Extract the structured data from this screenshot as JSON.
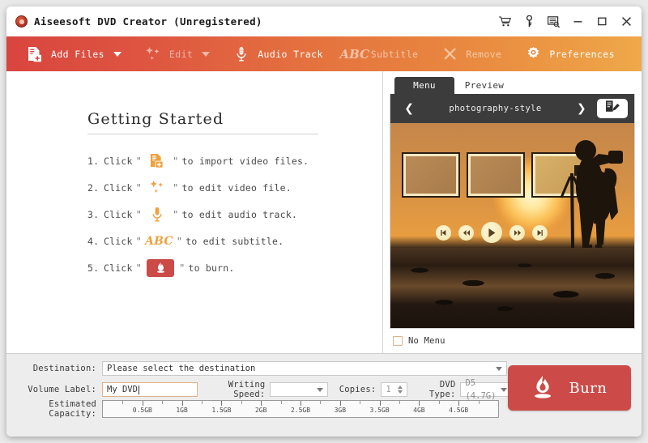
{
  "window": {
    "title": "Aiseesoft DVD Creator (Unregistered)",
    "logo_icon": "app-logo-icon",
    "controls": [
      {
        "name": "cart-icon",
        "label": "Cart"
      },
      {
        "name": "key-icon",
        "label": "Register"
      },
      {
        "name": "feedback-icon",
        "label": "Feedback"
      },
      {
        "name": "minimize-icon",
        "label": "Minimize"
      },
      {
        "name": "maximize-icon",
        "label": "Maximize"
      },
      {
        "name": "close-icon",
        "label": "Close"
      }
    ]
  },
  "toolbar": {
    "gradient_from": "#d9453f",
    "gradient_to": "#efa84a",
    "items": [
      {
        "label": "Add Files",
        "icon": "add-files-icon",
        "dropdown": true,
        "enabled": true
      },
      {
        "label": "Edit",
        "icon": "edit-sparkles-icon",
        "dropdown": true,
        "enabled": false
      },
      {
        "label": "Audio Track",
        "icon": "microphone-icon",
        "dropdown": false,
        "enabled": true
      },
      {
        "label": "Subtitle",
        "icon": "abc-icon",
        "dropdown": false,
        "enabled": false
      },
      {
        "label": "Remove",
        "icon": "close-x-icon",
        "dropdown": false,
        "enabled": false
      },
      {
        "label": "Preferences",
        "icon": "gear-icon",
        "dropdown": false,
        "enabled": true
      }
    ]
  },
  "getting_started": {
    "title": "Getting Started",
    "steps": [
      {
        "num": "1.",
        "click": "Click",
        "icon": "add-files-icon",
        "text": "to import video files."
      },
      {
        "num": "2.",
        "click": "Click",
        "icon": "edit-sparkles-icon",
        "text": "to edit video file."
      },
      {
        "num": "3.",
        "click": "Click",
        "icon": "microphone-icon",
        "text": "to edit audio track."
      },
      {
        "num": "4.",
        "click": "Click",
        "icon": "abc-icon",
        "text": "to edit subtitle."
      },
      {
        "num": "5.",
        "click": "Click",
        "icon": "burn-flame-icon",
        "text": "to burn."
      }
    ],
    "quote_open": "\"",
    "quote_close": "\"",
    "abc_text": "ABC"
  },
  "menu_panel": {
    "tabs": [
      {
        "label": "Menu",
        "active": true
      },
      {
        "label": "Preview",
        "active": false
      }
    ],
    "prev_icon": "chevron-left-icon",
    "next_icon": "chevron-right-icon",
    "template_name": "photography-style",
    "edit_icon": "edit-template-icon",
    "preview": {
      "description": "photographer silhouette at sunset with three photo frames",
      "frame_count": 3,
      "playback_controls": [
        "prev-icon",
        "rewind-icon",
        "play-icon",
        "forward-icon",
        "next-icon"
      ]
    },
    "no_menu": {
      "label": "No Menu",
      "checked": false
    }
  },
  "bottom": {
    "destination": {
      "label": "Destination:",
      "value": "Please select the destination",
      "placeholder": "Please select the destination"
    },
    "volume_label": {
      "label": "Volume Label:",
      "value": "My DVD"
    },
    "writing_speed": {
      "label": "Writing Speed:",
      "value": ""
    },
    "copies": {
      "label": "Copies:",
      "value": "1"
    },
    "dvd_type": {
      "label": "DVD Type:",
      "value": "D5 (4.7G)"
    },
    "estimated_capacity": {
      "label": "Estimated Capacity:",
      "ticks": [
        "0.5GB",
        "1GB",
        "1.5GB",
        "2GB",
        "2.5GB",
        "3GB",
        "3.5GB",
        "4GB",
        "4.5GB"
      ],
      "max": "4.7GB",
      "used": 0
    },
    "burn_button": {
      "label": "Burn",
      "icon": "burn-flame-icon",
      "color": "#cc4b48"
    }
  }
}
